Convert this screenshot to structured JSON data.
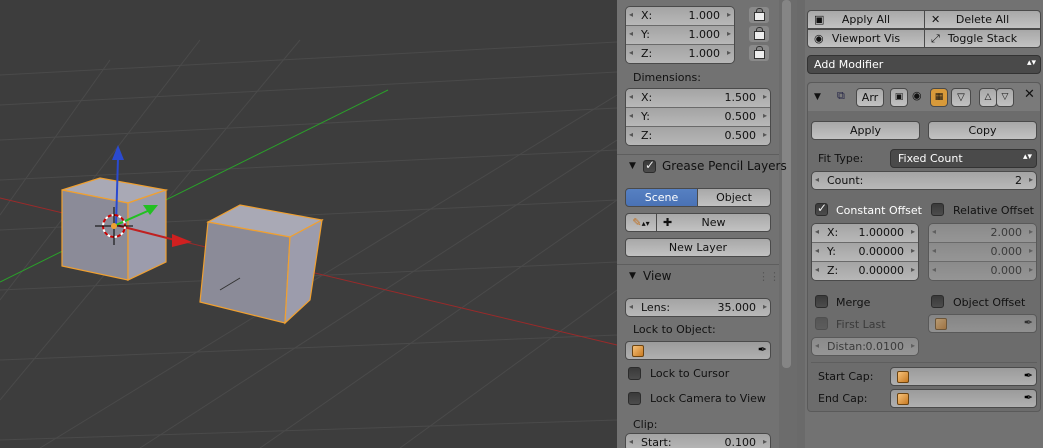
{
  "transform": {
    "scale": [
      {
        "axis": "X:",
        "value": "1.000"
      },
      {
        "axis": "Y:",
        "value": "1.000"
      },
      {
        "axis": "Z:",
        "value": "1.000"
      }
    ],
    "dimensions_label": "Dimensions:",
    "dimensions": [
      {
        "axis": "X:",
        "value": "1.500"
      },
      {
        "axis": "Y:",
        "value": "0.500"
      },
      {
        "axis": "Z:",
        "value": "0.500"
      }
    ]
  },
  "grease_pencil": {
    "title": "Grease Pencil Layers",
    "tabs": [
      "Scene",
      "Object"
    ],
    "active_tab": "Scene",
    "new_label": "New",
    "new_layer_label": "New Layer"
  },
  "view": {
    "title": "View",
    "lens_label": "Lens:",
    "lens_value": "35.000",
    "lock_to_object_label": "Lock to Object:",
    "lock_to_cursor": "Lock to Cursor",
    "lock_camera_to_view": "Lock Camera to View",
    "clip_label": "Clip:",
    "start_label": "Start:",
    "start_value": "0.100"
  },
  "modifiers": {
    "apply_all": "Apply All",
    "delete_all": "Delete All",
    "viewport_vis": "Viewport Vis",
    "toggle_stack": "Toggle Stack",
    "add_modifier": "Add Modifier",
    "name": "Arr",
    "apply": "Apply",
    "copy": "Copy",
    "fit_type_label": "Fit Type:",
    "fit_type_value": "Fixed Count",
    "count_label": "Count:",
    "count_value": "2",
    "constant_offset": "Constant Offset",
    "relative_offset": "Relative Offset",
    "constant": [
      {
        "axis": "X:",
        "value": "1.00000"
      },
      {
        "axis": "Y:",
        "value": "0.00000"
      },
      {
        "axis": "Z:",
        "value": "0.00000"
      }
    ],
    "relative_values": [
      "2.000",
      "0.000",
      "0.000"
    ],
    "merge": "Merge",
    "object_offset": "Object Offset",
    "first_last": "First Last",
    "distance_label": "Distan:",
    "distance_value": "0.0100",
    "start_cap": "Start Cap:",
    "end_cap": "End Cap:"
  },
  "colors": {
    "selected_outline": "#f0a030",
    "x_axis": "#9a2a2a",
    "y_axis": "#2aa02a",
    "z_axis": "#2a4ad0",
    "active_tab": "#5680c2"
  }
}
